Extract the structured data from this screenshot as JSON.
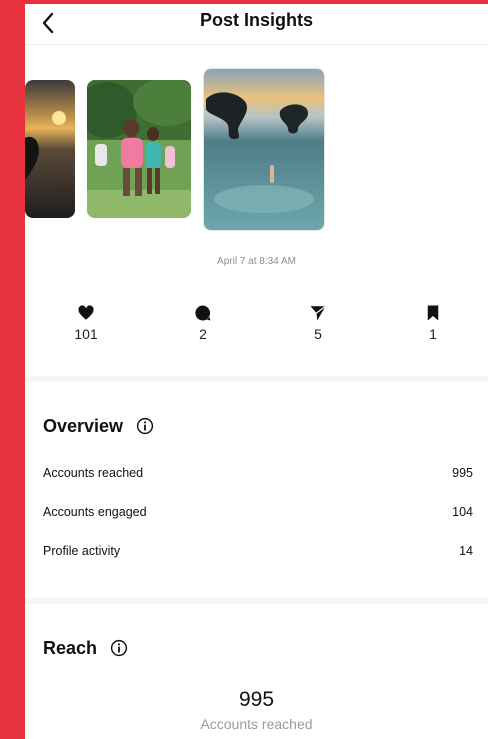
{
  "header": {
    "title": "Post Insights",
    "back_icon": "chevron-left-icon"
  },
  "post": {
    "timestamp": "April 7 at 8:34 AM"
  },
  "stats": [
    {
      "icon": "heart-icon",
      "value": "101"
    },
    {
      "icon": "comment-icon",
      "value": "2"
    },
    {
      "icon": "send-icon",
      "value": "5"
    },
    {
      "icon": "bookmark-icon",
      "value": "1"
    }
  ],
  "overview": {
    "title": "Overview",
    "rows": [
      {
        "label": "Accounts reached",
        "value": "995"
      },
      {
        "label": "Accounts engaged",
        "value": "104"
      },
      {
        "label": "Profile activity",
        "value": "14"
      }
    ]
  },
  "reach": {
    "title": "Reach",
    "value": "995",
    "caption": "Accounts reached"
  },
  "colors": {
    "background_accent": "#e8323f",
    "panel": "#ffffff",
    "muted_text": "#8e8e8e"
  }
}
